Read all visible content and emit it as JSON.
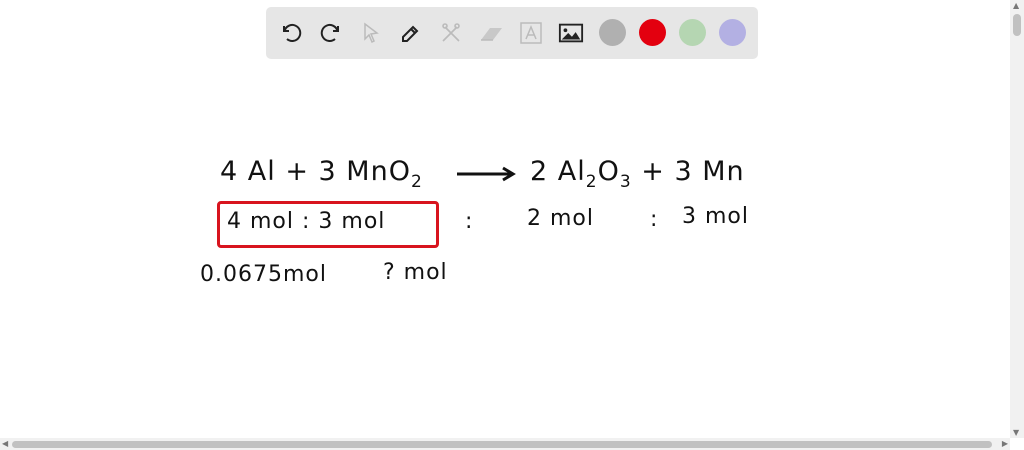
{
  "toolbar": {
    "tools": [
      "undo-icon",
      "redo-icon",
      "select-icon",
      "pen-icon",
      "tools-icon",
      "eraser-icon",
      "text-icon",
      "image-icon"
    ],
    "colors": [
      "#b0b0b0",
      "#e3000f",
      "#b5d6b2",
      "#b3b0e3"
    ]
  },
  "canvas": {
    "equation": {
      "left": "4 Al + 3 MnO",
      "left_sub": "2",
      "right1": "2 Al",
      "sub1": "2",
      "right2": "O",
      "sub2": "3",
      "right3": " + 3 Mn"
    },
    "ratio": {
      "boxed": "4 mol : 3 mol",
      "c3": ":",
      "v3": "2 mol",
      "c4": ":",
      "v4": "3 mol"
    },
    "given": {
      "al": "0.0675mol",
      "mno2": "? mol"
    }
  }
}
